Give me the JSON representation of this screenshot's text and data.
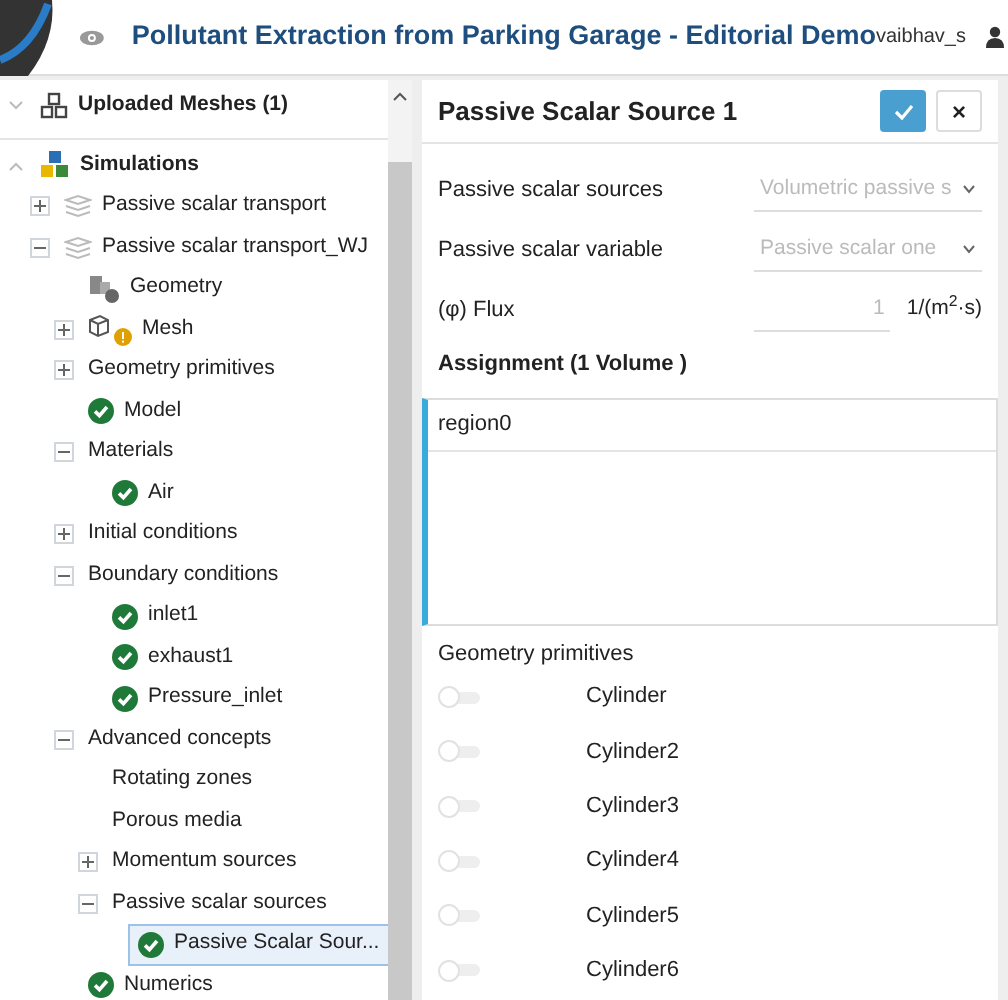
{
  "header": {
    "title": "Pollutant Extraction from Parking Garage - Editorial Demo",
    "user": "vaibhav_s"
  },
  "tree": [
    {
      "label": "Uploaded Meshes (1)",
      "kind": "meshes",
      "expanded": false,
      "selected": false
    },
    {
      "label": "Simulations",
      "kind": "simulations",
      "expanded": true,
      "selected": false,
      "children": [
        {
          "label": "Passive scalar transport",
          "kind": "layers",
          "expanded": false,
          "selected": false
        },
        {
          "label": "Passive scalar transport_WJ",
          "kind": "layers",
          "expanded": true,
          "selected": false,
          "children": [
            {
              "label": "Geometry",
              "kind": "geometry",
              "selected": false
            },
            {
              "label": "Mesh",
              "kind": "mesh",
              "warning": true,
              "expanded": false,
              "selected": false
            },
            {
              "label": "Geometry primitives",
              "kind": "plain",
              "expanded": false,
              "selected": false
            },
            {
              "label": "Model",
              "kind": "check",
              "selected": false
            },
            {
              "label": "Materials",
              "kind": "plain",
              "expanded": true,
              "selected": false,
              "children": [
                {
                  "label": "Air",
                  "kind": "check",
                  "selected": false
                }
              ]
            },
            {
              "label": "Initial conditions",
              "kind": "plain",
              "expanded": false,
              "selected": false
            },
            {
              "label": "Boundary conditions",
              "kind": "plain",
              "expanded": true,
              "selected": false,
              "children": [
                {
                  "label": "inlet1",
                  "kind": "check",
                  "selected": false
                },
                {
                  "label": "exhaust1",
                  "kind": "check",
                  "selected": false
                },
                {
                  "label": "Pressure_inlet",
                  "kind": "check",
                  "selected": false
                }
              ]
            },
            {
              "label": "Advanced concepts",
              "kind": "plain",
              "expanded": true,
              "selected": false,
              "children": [
                {
                  "label": "Rotating zones",
                  "kind": "plain",
                  "selected": false
                },
                {
                  "label": "Porous media",
                  "kind": "plain",
                  "selected": false
                },
                {
                  "label": "Momentum sources",
                  "kind": "plain",
                  "expanded": false,
                  "selected": false
                },
                {
                  "label": "Passive scalar sources",
                  "kind": "plain",
                  "expanded": true,
                  "selected": false,
                  "children": [
                    {
                      "label": "Passive Scalar Sour...",
                      "kind": "check",
                      "selected": true
                    }
                  ]
                }
              ]
            },
            {
              "label": "Numerics",
              "kind": "check",
              "selected": false
            }
          ]
        }
      ]
    }
  ],
  "panel": {
    "title": "Passive Scalar Source 1",
    "close": "×",
    "fields": [
      {
        "kind": "select",
        "label": "Passive scalar sources",
        "value": "Volumetric passive s"
      },
      {
        "kind": "select",
        "label": "Passive scalar variable",
        "value": "Passive scalar one"
      },
      {
        "kind": "number",
        "label": "(φ) Flux",
        "value": "1",
        "unit": "1/(m$^{2}$·s)"
      }
    ],
    "assignment": {
      "heading": "Assignment (1 Volume )",
      "items": [
        "region0"
      ]
    },
    "primitives": {
      "heading": "Geometry primitives",
      "items": [
        {
          "label": "Cylinder",
          "on": false
        },
        {
          "label": "Cylinder2",
          "on": false
        },
        {
          "label": "Cylinder3",
          "on": false
        },
        {
          "label": "Cylinder4",
          "on": false
        },
        {
          "label": "Cylinder5",
          "on": false
        },
        {
          "label": "Cylinder6",
          "on": false
        }
      ]
    }
  }
}
